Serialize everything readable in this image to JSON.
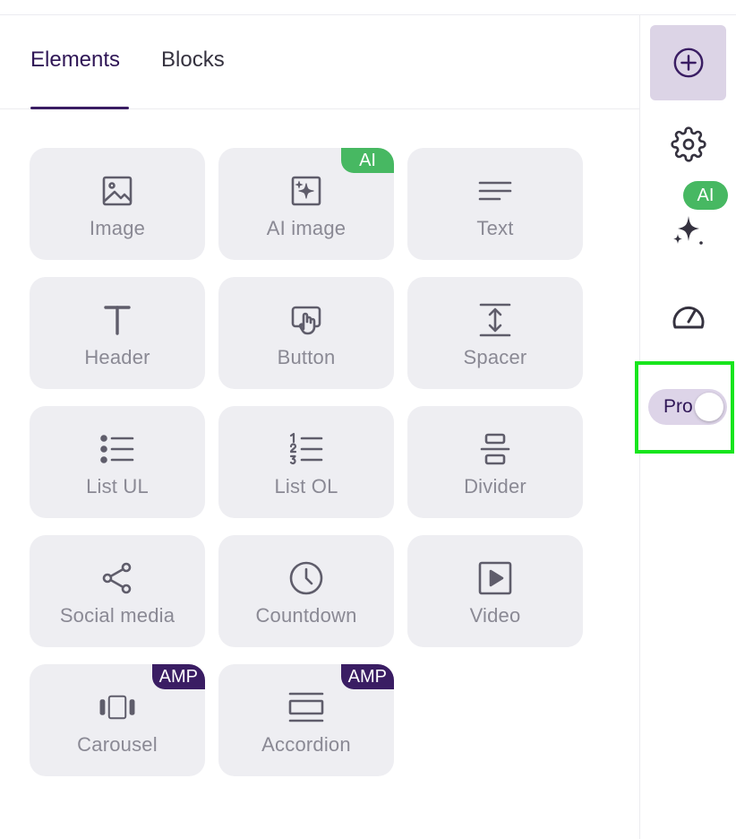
{
  "tabs": {
    "elements": "Elements",
    "blocks": "Blocks",
    "active": "elements"
  },
  "tiles": [
    {
      "label": "Image",
      "icon": "image-icon"
    },
    {
      "label": "AI image",
      "icon": "ai-image-icon",
      "badge": "AI"
    },
    {
      "label": "Text",
      "icon": "text-icon"
    },
    {
      "label": "Header",
      "icon": "header-icon"
    },
    {
      "label": "Button",
      "icon": "button-icon"
    },
    {
      "label": "Spacer",
      "icon": "spacer-icon"
    },
    {
      "label": "List UL",
      "icon": "list-ul-icon"
    },
    {
      "label": "List OL",
      "icon": "list-ol-icon"
    },
    {
      "label": "Divider",
      "icon": "divider-icon"
    },
    {
      "label": "Social media",
      "icon": "share-icon"
    },
    {
      "label": "Countdown",
      "icon": "clock-icon"
    },
    {
      "label": "Video",
      "icon": "video-icon"
    },
    {
      "label": "Carousel",
      "icon": "carousel-icon",
      "badge": "AMP"
    },
    {
      "label": "Accordion",
      "icon": "accordion-icon",
      "badge": "AMP"
    }
  ],
  "rail": {
    "ai_badge": "AI",
    "pro_label": "Pro",
    "pro_enabled": false
  },
  "colors": {
    "brand": "#3a1d63",
    "ai_green": "#47b862",
    "tile_bg": "#eeeef2",
    "icon": "#5f5d6b",
    "highlight": "#18e51d"
  }
}
